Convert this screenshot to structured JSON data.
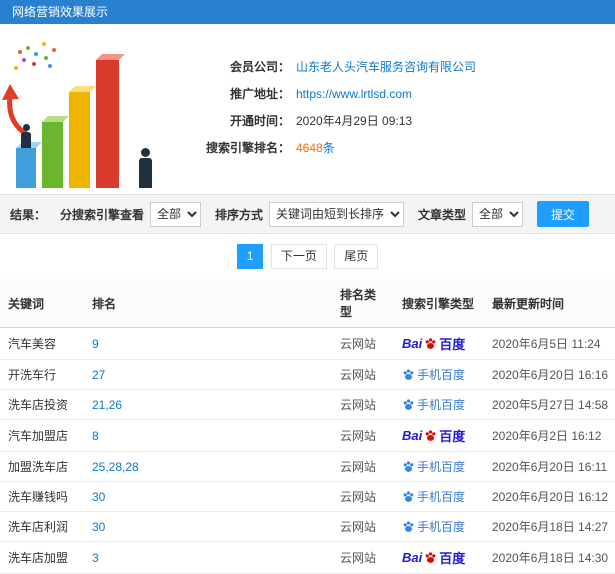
{
  "header": {
    "title": "网络营销效果展示"
  },
  "info": {
    "company_label": "会员公司：",
    "company_value": "山东老人头汽车服务咨询有限公司",
    "url_label": "推广地址：",
    "url_value": "https://www.lrtlsd.com",
    "open_label": "开通时间：",
    "open_value": "2020年4月29日 09:13",
    "rank_label": "搜索引擎排名：",
    "rank_value": "4648",
    "rank_suffix": "条"
  },
  "filters": {
    "result_label": "结果：",
    "engine_label": "分搜索引擎查看",
    "engine_value": "全部",
    "sort_label": "排序方式",
    "sort_value": "关键词由短到长排序",
    "article_label": "文章类型",
    "article_value": "全部",
    "submit_label": "提交"
  },
  "pagination": {
    "current": "1",
    "next": "下一页",
    "last": "尾页"
  },
  "engines": {
    "baidu": {
      "bai": "Bai",
      "du": "百度"
    },
    "mobile": {
      "label": "手机百度"
    }
  },
  "table": {
    "headers": [
      "关键词",
      "排名",
      "排名类型",
      "搜索引擎类型",
      "最新更新时间"
    ],
    "rows": [
      {
        "keyword": "汽车美容",
        "rank": "9",
        "rank_type": "云网站",
        "engine": "baidu",
        "time": "2020年6月5日 11:24"
      },
      {
        "keyword": "开洗车行",
        "rank": "27",
        "rank_type": "云网站",
        "engine": "mobile",
        "time": "2020年6月20日 16:16"
      },
      {
        "keyword": "洗车店投资",
        "rank": "21,26",
        "rank_type": "云网站",
        "engine": "mobile",
        "time": "2020年5月27日 14:58"
      },
      {
        "keyword": "汽车加盟店",
        "rank": "8",
        "rank_type": "云网站",
        "engine": "baidu",
        "time": "2020年6月2日 16:12"
      },
      {
        "keyword": "加盟洗车店",
        "rank": "25,28,28",
        "rank_type": "云网站",
        "engine": "mobile",
        "time": "2020年6月20日 16:11"
      },
      {
        "keyword": "洗车赚钱吗",
        "rank": "30",
        "rank_type": "云网站",
        "engine": "mobile",
        "time": "2020年6月20日 16:12"
      },
      {
        "keyword": "洗车店利润",
        "rank": "30",
        "rank_type": "云网站",
        "engine": "mobile",
        "time": "2020年6月18日 14:27"
      },
      {
        "keyword": "洗车店加盟",
        "rank": "3",
        "rank_type": "云网站",
        "engine": "baidu",
        "time": "2020年6月18日 14:30"
      }
    ]
  }
}
